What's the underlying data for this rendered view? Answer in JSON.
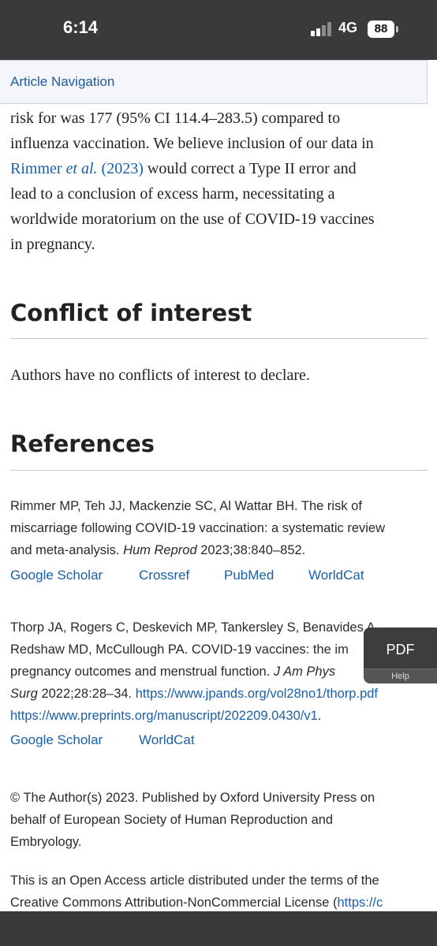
{
  "status_bar": {
    "time": "6:14",
    "network": "4G",
    "battery": "88"
  },
  "article_nav": {
    "label": "Article Navigation"
  },
  "intro": {
    "line1": "risk for was 177 (95% CI 114.4–283.5) compared to",
    "line2": "influenza vaccination. We believe inclusion of our data in",
    "line3_link_a": "Rimmer ",
    "line3_link_italic": "et al.",
    "line3_link_b": " (2023)",
    "line3_rest": " would correct a Type II error and",
    "line4": "lead to a conclusion of excess harm, necessitating a",
    "line5": "worldwide moratorium on the use of COVID-19 vaccines",
    "line6": "in pregnancy."
  },
  "conflict": {
    "heading": "Conflict of interest",
    "text": "Authors have no conflicts of interest to declare."
  },
  "references": {
    "heading": "References",
    "items": [
      {
        "line1": "Rimmer MP, Teh JJ, Mackenzie SC, Al Wattar BH. The risk of",
        "line2": "miscarriage following COVID-19 vaccination: a systematic review",
        "line3_plain": "and meta-analysis. ",
        "line3_italic": "Hum Reprod",
        "line3_end": " 2023;38:840–852.",
        "links": [
          "Google Scholar",
          "Crossref",
          "PubMed",
          "WorldCat"
        ]
      },
      {
        "line1": "Thorp JA, Rogers C, Deskevich MP, Tankersley S, Benavides A,",
        "line2": "Redshaw MD, McCullough PA. COVID-19 vaccines: the im",
        "line3_plain": "pregnancy outcomes and menstrual function. ",
        "line3_italic": "J Am Phys",
        "line4_italic": "Surg",
        "line4_plain": " 2022;28:28–34. ",
        "line4_url": "https://www.jpands.org/vol28no1/thorp.pdf",
        "line5_url": "https://www.preprints.org/manuscript/202209.0430/v1",
        "line5_end": ".",
        "links": [
          "Google Scholar",
          "WorldCat"
        ]
      }
    ]
  },
  "copyright": {
    "line1": "© The Author(s) 2023. Published by Oxford University Press on",
    "line2": "behalf of European Society of Human Reproduction and",
    "line3": "Embryology."
  },
  "license": {
    "line1": "This is an Open Access article distributed under the terms of the",
    "line2_plain": "Creative Commons Attribution-NonCommercial License (",
    "line2_link": "https://c"
  },
  "pdf_widget": {
    "label": "PDF",
    "help": "Help"
  }
}
